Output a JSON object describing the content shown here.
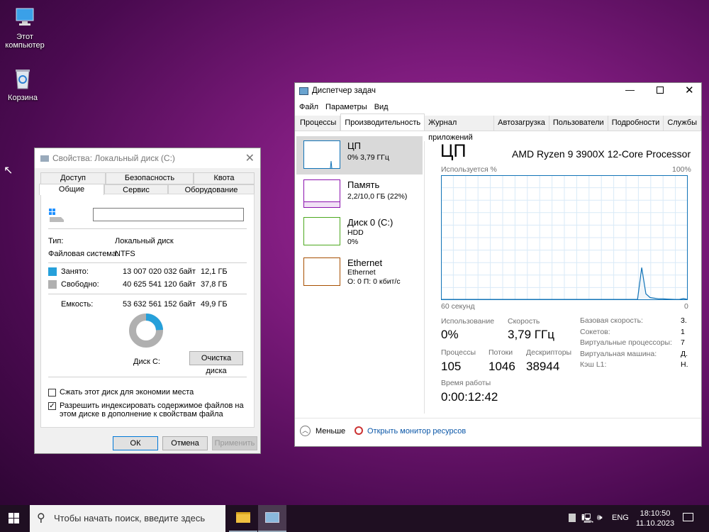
{
  "desktop": {
    "icons": [
      {
        "label": "Этот компьютер",
        "icon": "computer-icon"
      },
      {
        "label": "Корзина",
        "icon": "recycle-bin-icon"
      }
    ]
  },
  "props": {
    "title": "Свойства: Локальный диск (C:)",
    "tabs_top": [
      "Доступ",
      "Безопасность",
      "Квота"
    ],
    "tabs_bottom": [
      "Общие",
      "Сервис",
      "Оборудование"
    ],
    "name_value": "",
    "type_label": "Тип:",
    "type_value": "Локальный диск",
    "fs_label": "Файловая система:",
    "fs_value": "NTFS",
    "used_label": "Занято:",
    "used_bytes": "13 007 020 032 байт",
    "used_gb": "12,1 ГБ",
    "free_label": "Свободно:",
    "free_bytes": "40 625 541 120 байт",
    "free_gb": "37,8 ГБ",
    "cap_label": "Емкость:",
    "cap_bytes": "53 632 561 152 байт",
    "cap_gb": "49,9 ГБ",
    "used_fraction": 0.2425,
    "used_color": "#26a0da",
    "free_color": "#b0b0b0",
    "disk_label": "Диск C:",
    "cleanup": "Очистка диска",
    "compress_label": "Сжать этот диск для экономии места",
    "compress_checked": false,
    "index_label": "Разрешить индексировать содержимое файлов на этом диске в дополнение к свойствам файла",
    "index_checked": true,
    "ok": "ОК",
    "cancel": "Отмена",
    "apply": "Применить"
  },
  "tm": {
    "title": "Диспетчер задач",
    "menu": [
      "Файл",
      "Параметры",
      "Вид"
    ],
    "tabs": [
      "Процессы",
      "Производительность",
      "Журнал приложений",
      "Автозагрузка",
      "Пользователи",
      "Подробности",
      "Службы"
    ],
    "side": [
      {
        "name": "ЦП",
        "sub": "0%  3,79 ГГц",
        "color": "#1173b7"
      },
      {
        "name": "Память",
        "sub": "2,2/10,0 ГБ (22%)",
        "color": "#8b12ae"
      },
      {
        "name": "Диск 0 (C:)",
        "sub": "HDD",
        "sub2": "0%",
        "color": "#4da81f"
      },
      {
        "name": "Ethernet",
        "sub": "Ethernet",
        "sub2": "О: 0  П: 0 кбит/с",
        "color": "#a74f01"
      }
    ],
    "header": "ЦП",
    "cpu_name": "AMD Ryzen 9 3900X 12-Core Processor",
    "graph_label": "Используется %",
    "graph_max": "100%",
    "graph_time": "60 секунд",
    "graph_min": "0",
    "cpu_history": [
      0.5,
      0.5,
      0.5,
      0.5,
      0.5,
      0.5,
      0.5,
      0.5,
      0.5,
      0.5,
      0.5,
      0.5,
      0.5,
      0.5,
      0.5,
      0.5,
      0.5,
      0.5,
      0.5,
      0.5,
      0.5,
      0.5,
      0.5,
      0.5,
      0.5,
      0.5,
      0.5,
      0.5,
      0.5,
      0.5,
      0.5,
      0.5,
      0.5,
      0.5,
      0.5,
      0.5,
      0.5,
      0.5,
      0.5,
      0.5,
      0.5,
      0.5,
      0.5,
      0.5,
      0.5,
      0.5,
      0.5,
      0.5,
      26,
      5,
      2,
      1.5,
      1,
      1,
      0.8,
      0.6,
      0.5,
      0.5,
      1.2,
      0.5
    ],
    "stats": {
      "usage_label": "Использование",
      "usage": "0%",
      "speed_label": "Скорость",
      "speed": "3,79 ГГц",
      "proc_label": "Процессы",
      "proc": "105",
      "threads_label": "Потоки",
      "threads": "1046",
      "handles_label": "Дескрипторы",
      "handles": "38944",
      "uptime_label": "Время работы",
      "uptime": "0:00:12:42"
    },
    "info": [
      {
        "k": "Базовая скорость:",
        "v": "3."
      },
      {
        "k": "Сокетов:",
        "v": "1"
      },
      {
        "k": "Виртуальные процессоры:",
        "v": "7"
      },
      {
        "k": "Виртуальная машина:",
        "v": "Д."
      },
      {
        "k": "Кэш L1:",
        "v": "Н."
      }
    ],
    "less": "Меньше",
    "monitor": "Открыть монитор ресурсов"
  },
  "taskbar": {
    "search": "Чтобы начать поиск, введите здесь",
    "lang": "ENG",
    "time": "18:10:50",
    "date": "11.10.2023"
  }
}
